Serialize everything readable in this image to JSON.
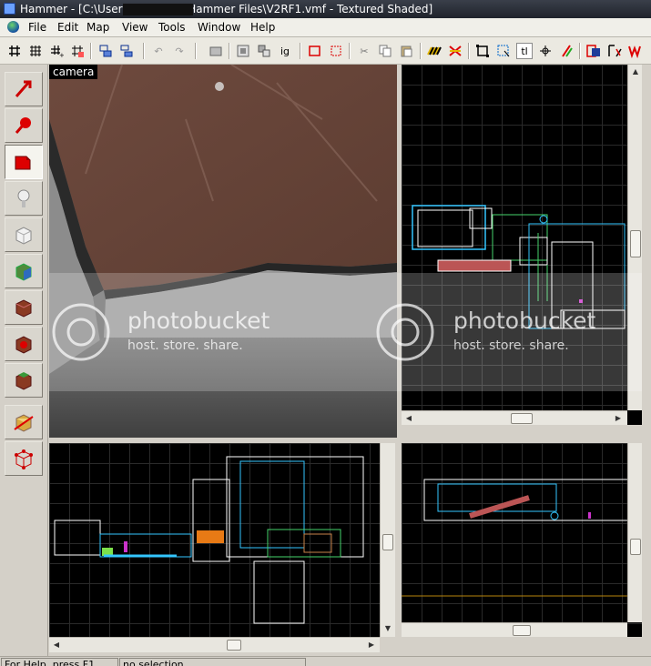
{
  "window": {
    "title": "Hammer - [C:\\Users\\                    \\Desktop\\Hammer Files\\V2RF1.vmf - Textured Shaded]"
  },
  "menu": [
    "File",
    "Edit",
    "Map",
    "View",
    "Tools",
    "Window",
    "Help"
  ],
  "toolbar": {
    "icons": [
      "grid-smaller-icon",
      "grid-larger-icon",
      "grid-toggle-icon",
      "grid-3d-icon",
      "group-icon",
      "ungroup-icon",
      "undo-icon",
      "redo-icon",
      "carve-icon",
      "tie-to-entity-icon",
      "move-to-world-icon",
      "ignore-groups-label-icon",
      "hide-icon",
      "select-hidden-icon",
      "cut-icon",
      "copy-icon",
      "paste-icon",
      "texture-lock-icon",
      "texture-app-icon",
      "select-bounds-icon",
      "select-tool-icon",
      "toggle-helper-label-icon",
      "toggle-3d-icon",
      "vertex-tool-icon",
      "compile-icon",
      "entity-report-icon",
      "cordon-icon"
    ],
    "ignore_groups_label": "ig",
    "texture_lock_label": "tl"
  },
  "left_tools": [
    "selection-tool-icon",
    "magnify-tool-icon",
    "camera-tool-icon",
    "entity-tool-icon",
    "block-tool-icon",
    "texture-app-tool-icon",
    "apply-texture-tool-icon",
    "decal-tool-icon",
    "overlay-tool-icon",
    "clipping-tool-icon",
    "vertex-tool-icon"
  ],
  "viewports": {
    "camera_label": "camera",
    "colors": {
      "wall": "#5a3d33",
      "floor": "#6a6a6a",
      "grid_line": "#2a2a2a",
      "brush_white": "#ffffff",
      "brush_cyan": "#33c6ff",
      "brush_green": "#46d46b",
      "entity_orange": "#e87a15"
    }
  },
  "watermark": {
    "brand": "photobucket",
    "tagline": "host. store. share."
  },
  "status": {
    "help": "For Help, press F1",
    "selection": "no selection"
  }
}
